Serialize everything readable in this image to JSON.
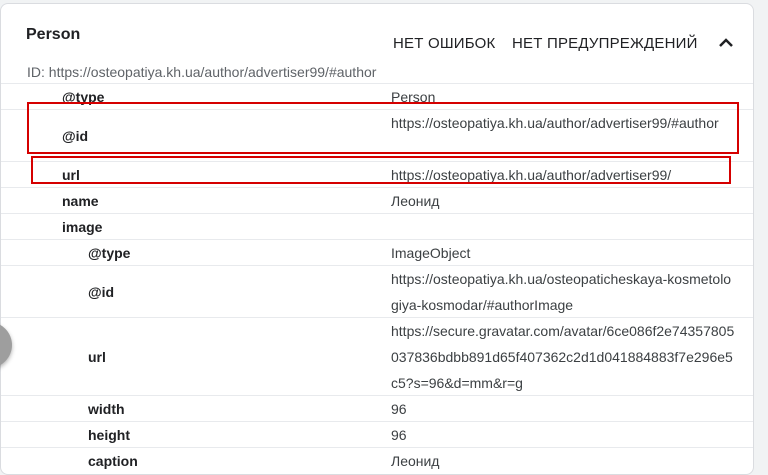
{
  "card": {
    "title": "Person",
    "errors_label": "НЕТ ОШИБОК",
    "warnings_label": "НЕТ ПРЕДУПРЕЖДЕНИЙ",
    "id_line": "ID: https://osteopatiya.kh.ua/author/advertiser99/#author"
  },
  "rows": {
    "r0": {
      "key": "@type",
      "value": "Person"
    },
    "r1": {
      "key": "@id",
      "value": "https://osteopatiya.kh.ua/author/advertiser99/#author"
    },
    "r2": {
      "key": "url",
      "value": "https://osteopatiya.kh.ua/author/advertiser99/"
    },
    "r3": {
      "key": "name",
      "value": "Леонид"
    },
    "r4": {
      "key": "image",
      "value": ""
    },
    "r5": {
      "key": "@type",
      "value": "ImageObject"
    },
    "r6": {
      "key": "@id",
      "value": "https://osteopatiya.kh.ua/osteopaticheskaya-kosmetologiya-kosmodar/#authorImage"
    },
    "r7": {
      "key": "url",
      "value": "https://secure.gravatar.com/avatar/6ce086f2e74357805037836bdbb891d65f407362c2d1d041884883f7e296e5c5?s=96&d=mm&r=g"
    },
    "r8": {
      "key": "width",
      "value": "96"
    },
    "r9": {
      "key": "height",
      "value": "96"
    },
    "r10": {
      "key": "caption",
      "value": "Леонид"
    }
  },
  "icons": {
    "collapse": "chevron-up-icon"
  },
  "colors": {
    "highlight": "#d50000"
  }
}
